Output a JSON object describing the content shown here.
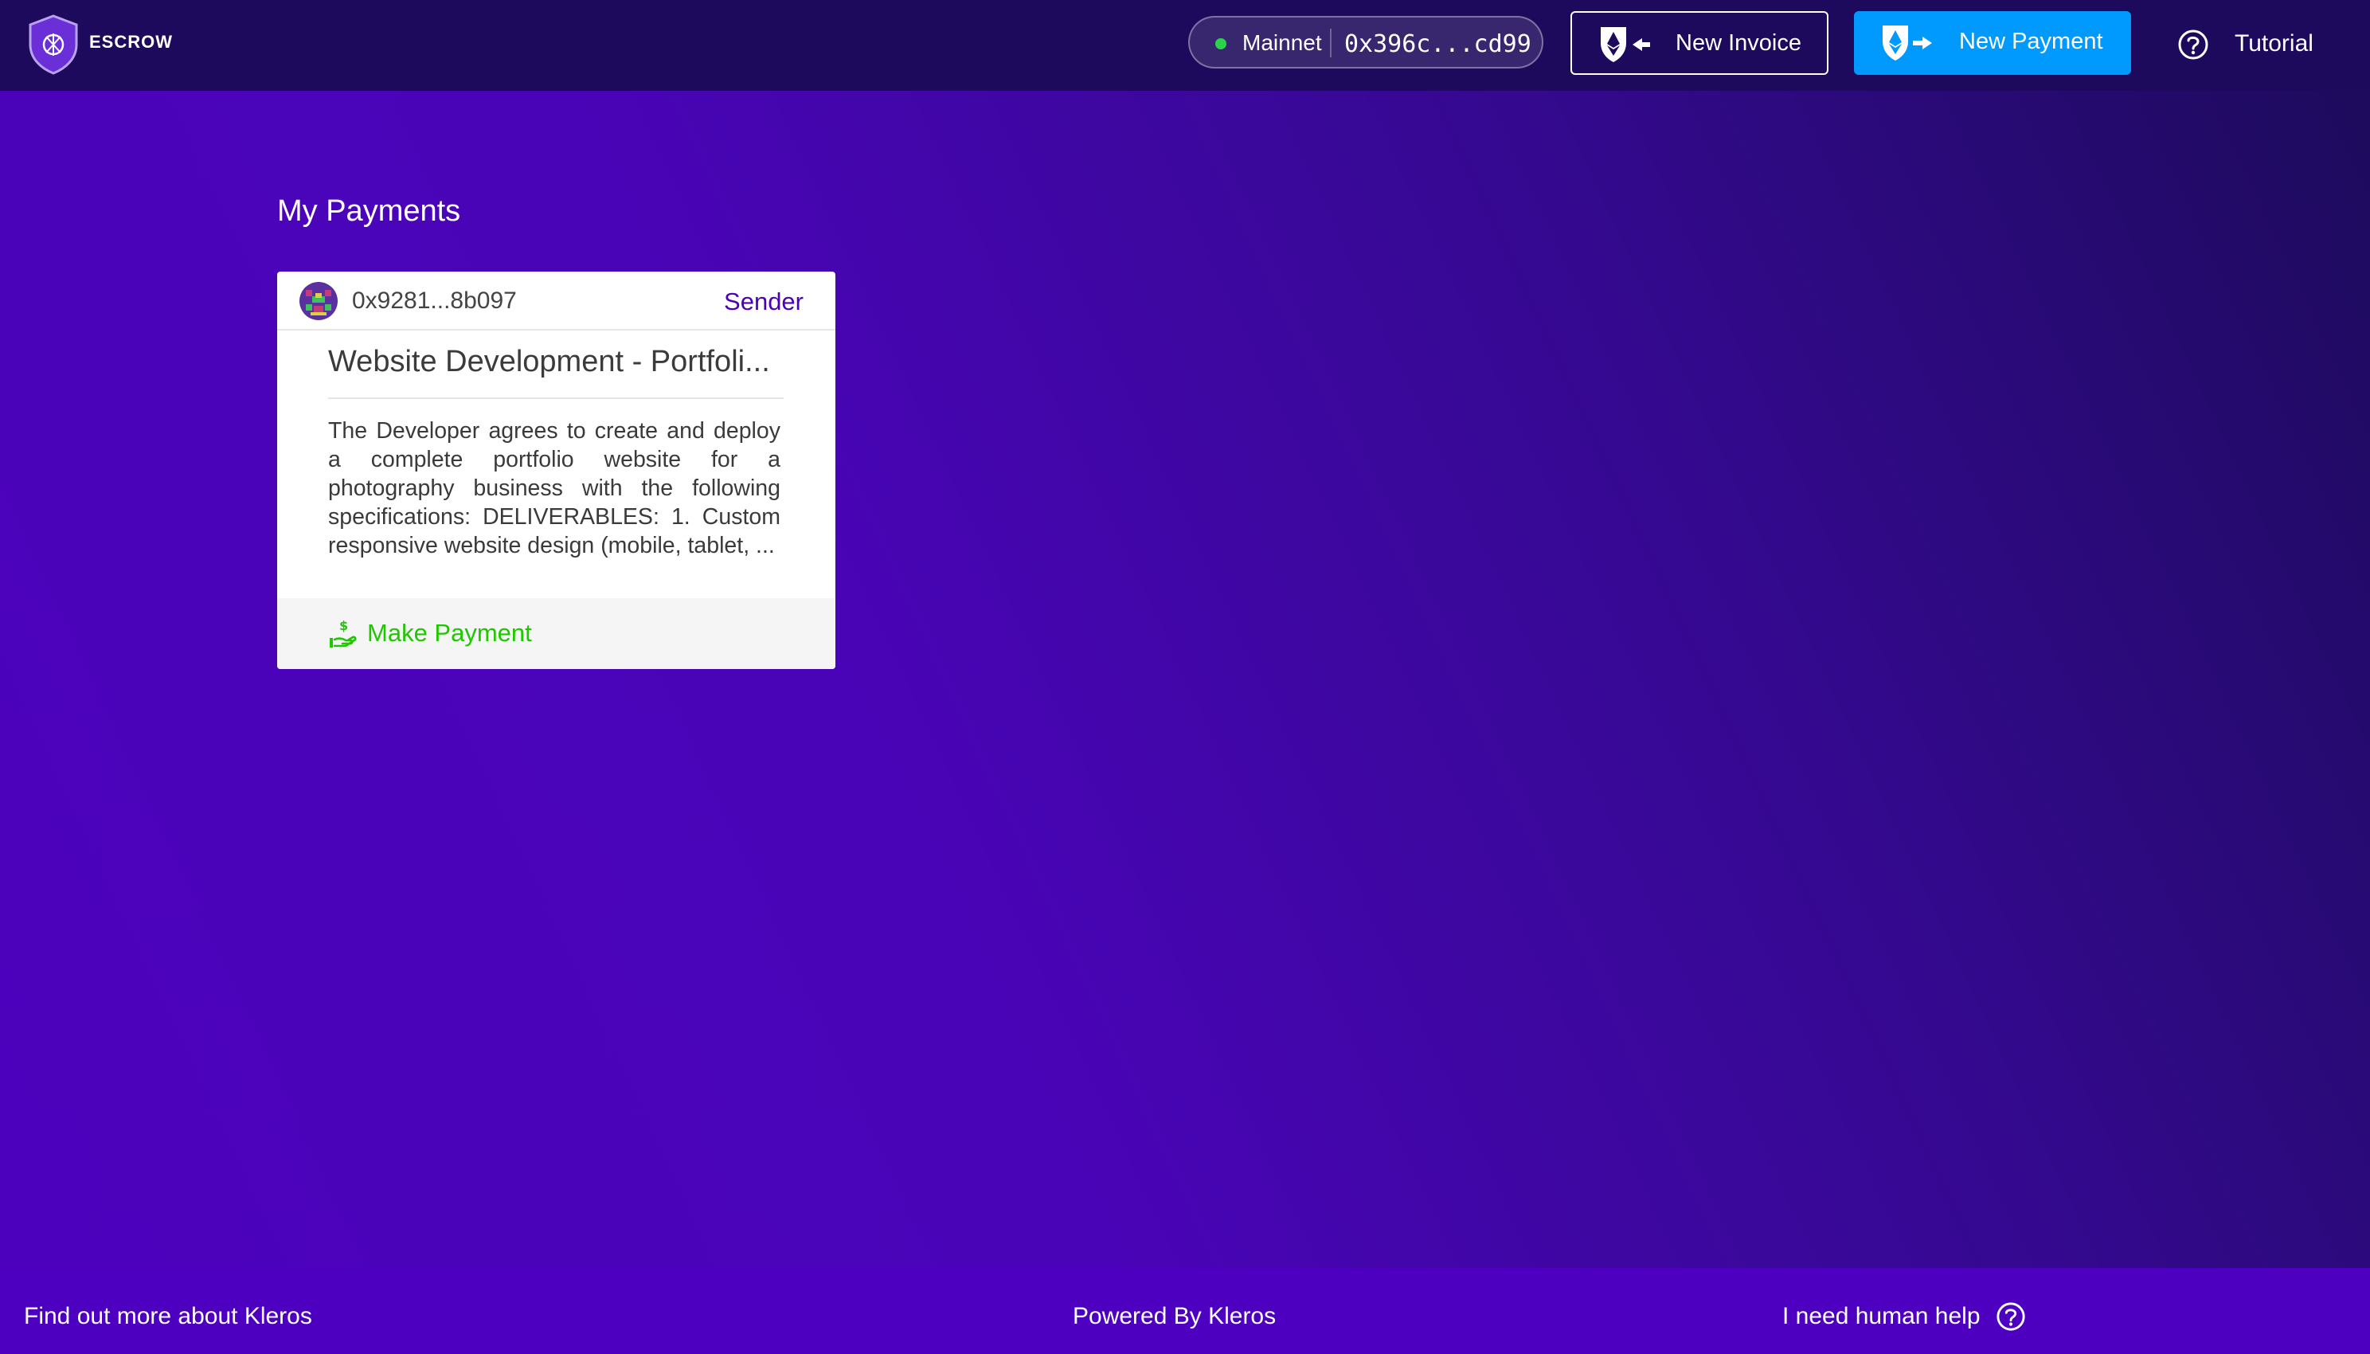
{
  "header": {
    "logo_text": "ESCROW",
    "network": {
      "label": "Mainnet",
      "address": "0x396c...cd99",
      "status_color": "#2ad44a"
    },
    "new_invoice_label": "New Invoice",
    "new_payment_label": "New Payment",
    "tutorial_label": "Tutorial",
    "brand_color": "#009aff"
  },
  "main": {
    "title": "My Payments",
    "cards": [
      {
        "address": "0x9281...8b097",
        "role": "Sender",
        "title": "Website Development - Portfoli...",
        "description": "The Developer agrees to create and deploy a complete portfolio website for a photography business with the following specifications: DELIVERABLES: 1. Custom responsive website design (mobile, tablet, ...",
        "action_label": "Make Payment",
        "action_color": "#1fc700"
      }
    ]
  },
  "footer": {
    "left_link": "Find out more about Kleros",
    "center_text": "Powered By Kleros",
    "right_link": "I need human help"
  }
}
